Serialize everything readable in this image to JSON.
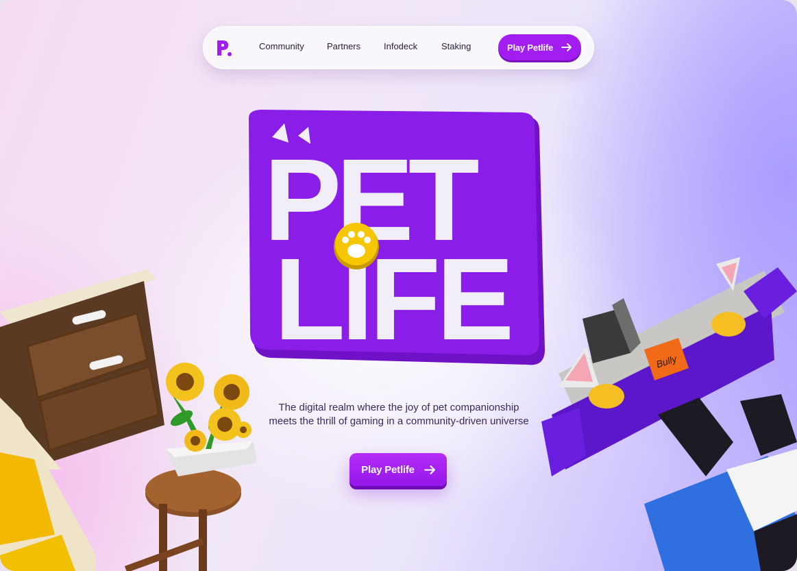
{
  "nav": {
    "logo_icon": "petlife-p-logo-icon",
    "links": [
      "Community",
      "Partners",
      "Infodeck",
      "Staking"
    ],
    "cta_label": "Play Petlife",
    "cta_icon": "arrow-right-icon"
  },
  "hero": {
    "logo_lines": [
      "PET",
      "LIFE"
    ],
    "tagline_line1": "The digital realm where the joy of pet companionship",
    "tagline_line2": "meets the thrill of gaming in a community-driven universe",
    "cta_label": "Play Petlife",
    "cta_icon": "arrow-right-icon"
  },
  "decor": {
    "pillow_text": "Bully",
    "left_items": [
      "nightstand",
      "sunflower-pot",
      "side-table"
    ],
    "right_items": [
      "purple-sofa",
      "laptop",
      "bone-pillows",
      "dog"
    ]
  },
  "colors": {
    "accent": "#a21df0",
    "logo_purple": "#8a1ee8",
    "logo_text": "#f1eef8",
    "paw_yellow": "#f6c700"
  }
}
